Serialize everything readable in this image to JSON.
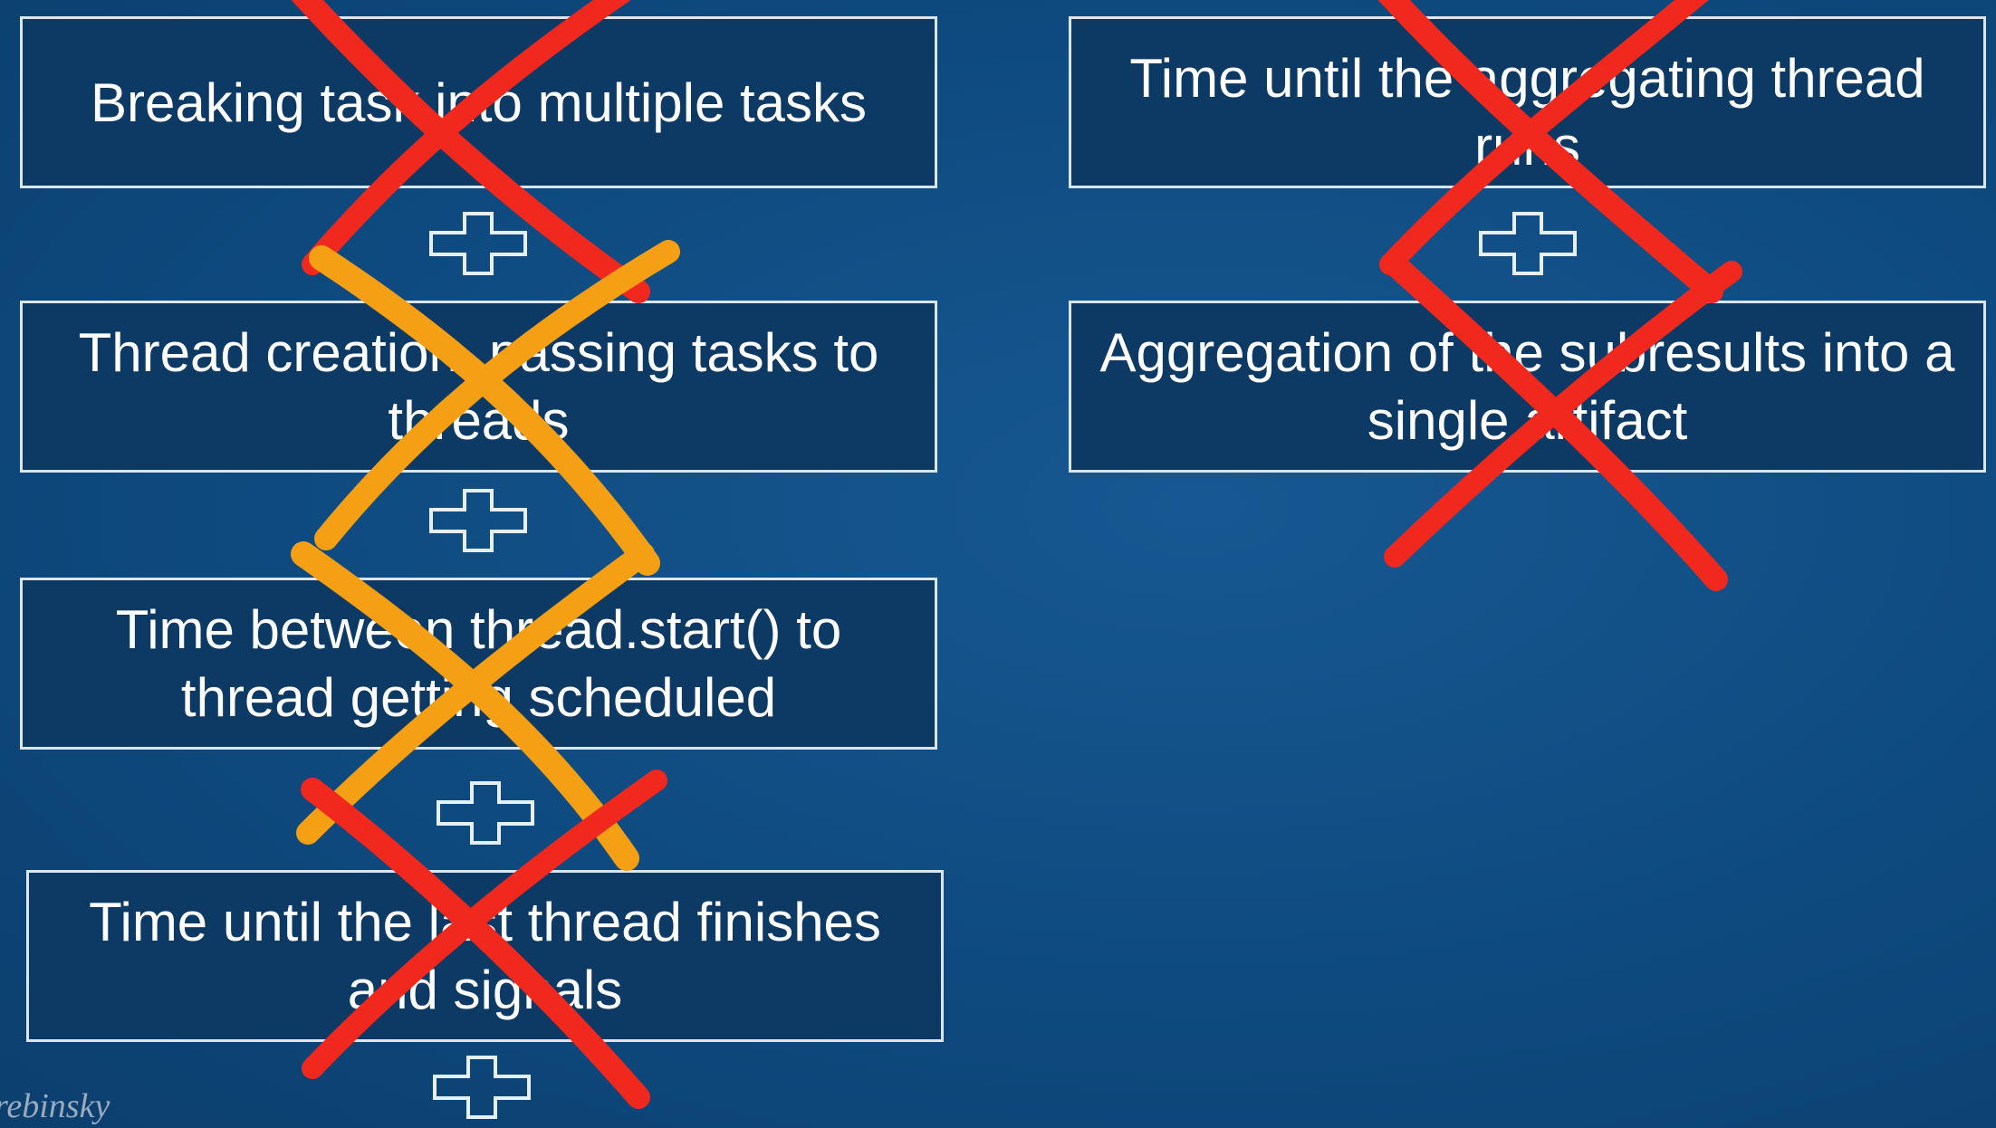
{
  "left_column": {
    "boxes": [
      {
        "text": "Breaking task into multiple tasks"
      },
      {
        "text": "Thread creation, passing tasks to threads"
      },
      {
        "text": "Time between thread.start() to thread getting scheduled"
      },
      {
        "text": "Time until the last thread finishes and signals"
      }
    ]
  },
  "right_column": {
    "boxes": [
      {
        "text": "Time until the aggregating thread runs"
      },
      {
        "text": "Aggregation of the subresults into a single artifact"
      }
    ]
  },
  "author_credit": "rebinsky",
  "icons": {
    "plus": "plus-icon",
    "cross_out": "cross-out-mark"
  },
  "colors": {
    "background": "#0f4a7d",
    "box_fill": "#0c3a64",
    "box_border": "#dbe6f2",
    "text": "#ffffff",
    "red_mark": "#f0281e",
    "orange_mark": "#f5a014"
  }
}
